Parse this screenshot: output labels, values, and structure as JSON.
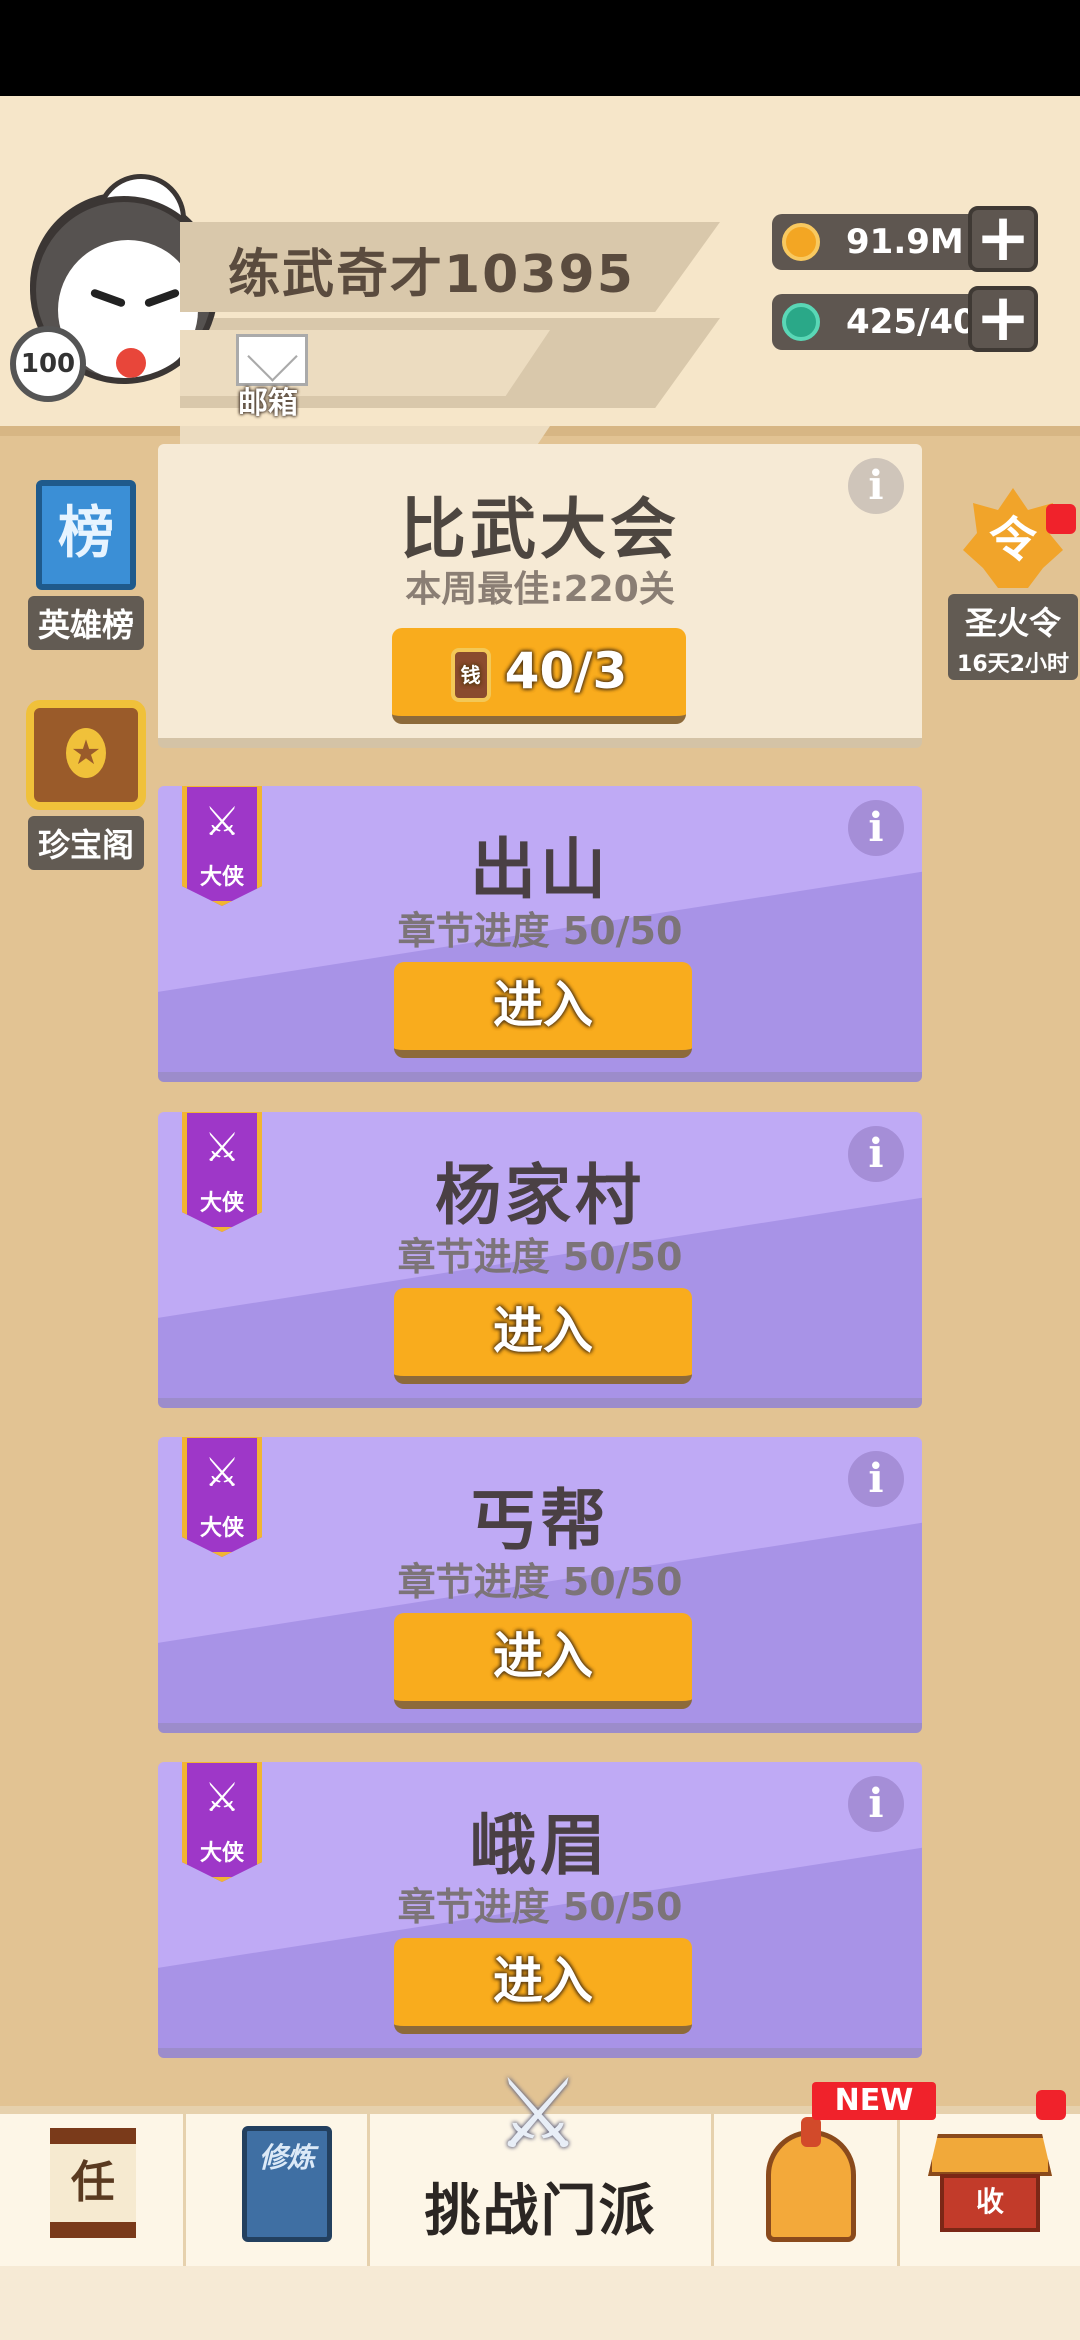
{
  "profile": {
    "level": "100",
    "name": "练武奇才10395",
    "mail_label": "邮箱"
  },
  "resources": {
    "gold_value": "91.9M",
    "jade_value": "425/40"
  },
  "side_left": {
    "ranking_label": "英雄榜",
    "ranking_icon_char": "榜",
    "treasure_label": "珍宝阁"
  },
  "side_right": {
    "token_label": "圣火令",
    "token_icon_char": "令",
    "token_timer": "16天2小时"
  },
  "tournament": {
    "title": "比武大会",
    "best": "本周最佳:220关",
    "ticket_char": "钱",
    "ticket_count": "40/3"
  },
  "chapters": [
    {
      "rank": "大侠",
      "title": "出山",
      "progress": "章节进度 50/50",
      "button": "进入"
    },
    {
      "rank": "大侠",
      "title": "杨家村",
      "progress": "章节进度 50/50",
      "button": "进入"
    },
    {
      "rank": "大侠",
      "title": "丐帮",
      "progress": "章节进度 50/50",
      "button": "进入"
    },
    {
      "rank": "大侠",
      "title": "峨眉",
      "progress": "章节进度 50/50",
      "button": "进入"
    }
  ],
  "bottom_nav": {
    "tasks_char": "任",
    "cultivate_chars": "修炼",
    "challenge_label": "挑战门派",
    "new_badge": "NEW",
    "shop_char": "收"
  },
  "colors": {
    "background": "#e2c393",
    "chapter_card": "#bfaaf5",
    "button_gold": "#f9ac1d",
    "badge_red": "#f0222b"
  },
  "icons": {
    "info": "info-icon",
    "plus": "plus-icon",
    "mail": "mail-icon",
    "swords": "crossed-swords-icon"
  }
}
